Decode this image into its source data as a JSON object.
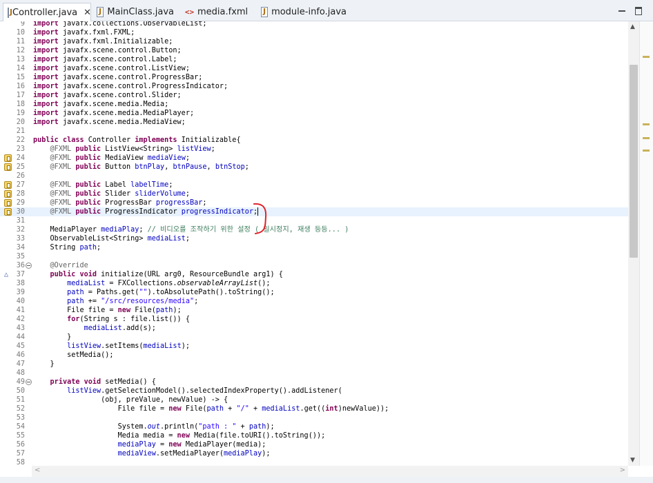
{
  "tabs": [
    {
      "label": "Controller.java",
      "icon": "java-file-icon",
      "active": true,
      "closable": true
    },
    {
      "label": "MainClass.java",
      "icon": "java-file-icon",
      "active": false
    },
    {
      "label": "media.fxml",
      "icon": "fxml-file-icon",
      "active": false
    },
    {
      "label": "module-info.java",
      "icon": "java-file-icon",
      "active": false
    }
  ],
  "close_glyph": "✕",
  "colors": {
    "keyword": "#7f0055",
    "field": "#0000c0",
    "string": "#2a00ff",
    "annotation": "#646464",
    "comment": "#3f7f5f",
    "current_line": "#e8f2fe",
    "annotation_mark": "#e0232a"
  },
  "editor": {
    "current_line": "30",
    "lines": [
      {
        "n": "9",
        "code": "import javafx.collections.ObservableList;"
      },
      {
        "n": "10",
        "code": "import javafx.fxml.FXML;"
      },
      {
        "n": "11",
        "code": "import javafx.fxml.Initializable;"
      },
      {
        "n": "12",
        "code": "import javafx.scene.control.Button;"
      },
      {
        "n": "13",
        "code": "import javafx.scene.control.Label;"
      },
      {
        "n": "14",
        "code": "import javafx.scene.control.ListView;"
      },
      {
        "n": "15",
        "code": "import javafx.scene.control.ProgressBar;"
      },
      {
        "n": "16",
        "code": "import javafx.scene.control.ProgressIndicator;"
      },
      {
        "n": "17",
        "code": "import javafx.scene.control.Slider;"
      },
      {
        "n": "18",
        "code": "import javafx.scene.media.Media;"
      },
      {
        "n": "19",
        "code": "import javafx.scene.media.MediaPlayer;"
      },
      {
        "n": "20",
        "code": "import javafx.scene.media.MediaView;"
      },
      {
        "n": "21",
        "code": ""
      },
      {
        "n": "22",
        "code": "public class Controller implements Initializable{"
      },
      {
        "n": "23",
        "code": "    @FXML public ListView<String> listView;"
      },
      {
        "n": "24",
        "code": "    @FXML public MediaView mediaView;",
        "marker": "warning"
      },
      {
        "n": "25",
        "code": "    @FXML public Button btnPlay, btnPause, btnStop;",
        "marker": "warning"
      },
      {
        "n": "26",
        "code": ""
      },
      {
        "n": "27",
        "code": "    @FXML public Label labelTime;",
        "marker": "warning"
      },
      {
        "n": "28",
        "code": "    @FXML public Slider sliderVolume;",
        "marker": "warning"
      },
      {
        "n": "29",
        "code": "    @FXML public ProgressBar progressBar;",
        "marker": "warning"
      },
      {
        "n": "30",
        "code": "    @FXML public ProgressIndicator progressIndicator;",
        "marker": "warning"
      },
      {
        "n": "31",
        "code": ""
      },
      {
        "n": "32",
        "code": "    MediaPlayer mediaPlay; // 비디오를 조작하기 위한 설정 ( 일시정지, 재생 등등... )"
      },
      {
        "n": "33",
        "code": "    ObservableList<String> mediaList;"
      },
      {
        "n": "34",
        "code": "    String path;"
      },
      {
        "n": "35",
        "code": ""
      },
      {
        "n": "36",
        "code": "    @Override",
        "fold": true
      },
      {
        "n": "37",
        "code": "    public void initialize(URL arg0, ResourceBundle arg1) {",
        "marker": "override"
      },
      {
        "n": "38",
        "code": "        mediaList = FXCollections.observableArrayList();"
      },
      {
        "n": "39",
        "code": "        path = Paths.get(\"\").toAbsolutePath().toString();"
      },
      {
        "n": "40",
        "code": "        path += \"/src/resources/media\";"
      },
      {
        "n": "41",
        "code": "        File file = new File(path);"
      },
      {
        "n": "42",
        "code": "        for(String s : file.list()) {"
      },
      {
        "n": "43",
        "code": "            mediaList.add(s);"
      },
      {
        "n": "44",
        "code": "        }"
      },
      {
        "n": "45",
        "code": "        listView.setItems(mediaList);"
      },
      {
        "n": "46",
        "code": "        setMedia();"
      },
      {
        "n": "47",
        "code": "    }"
      },
      {
        "n": "48",
        "code": ""
      },
      {
        "n": "49",
        "code": "    private void setMedia() {",
        "fold": true
      },
      {
        "n": "50",
        "code": "        listView.getSelectionModel().selectedIndexProperty().addListener("
      },
      {
        "n": "51",
        "code": "                (obj, preValue, newValue) -> {"
      },
      {
        "n": "52",
        "code": "                    File file = new File(path + \"/\" + mediaList.get((int)newValue));"
      },
      {
        "n": "53",
        "code": ""
      },
      {
        "n": "54",
        "code": "                    System.out.println(\"path : \" + path);"
      },
      {
        "n": "55",
        "code": "                    Media media = new Media(file.toURI().toString());"
      },
      {
        "n": "56",
        "code": "                    mediaPlay = new MediaPlayer(media);"
      },
      {
        "n": "57",
        "code": "                    mediaView.setMediaPlayer(mediaPlay);"
      },
      {
        "n": "58",
        "code": ""
      }
    ]
  }
}
